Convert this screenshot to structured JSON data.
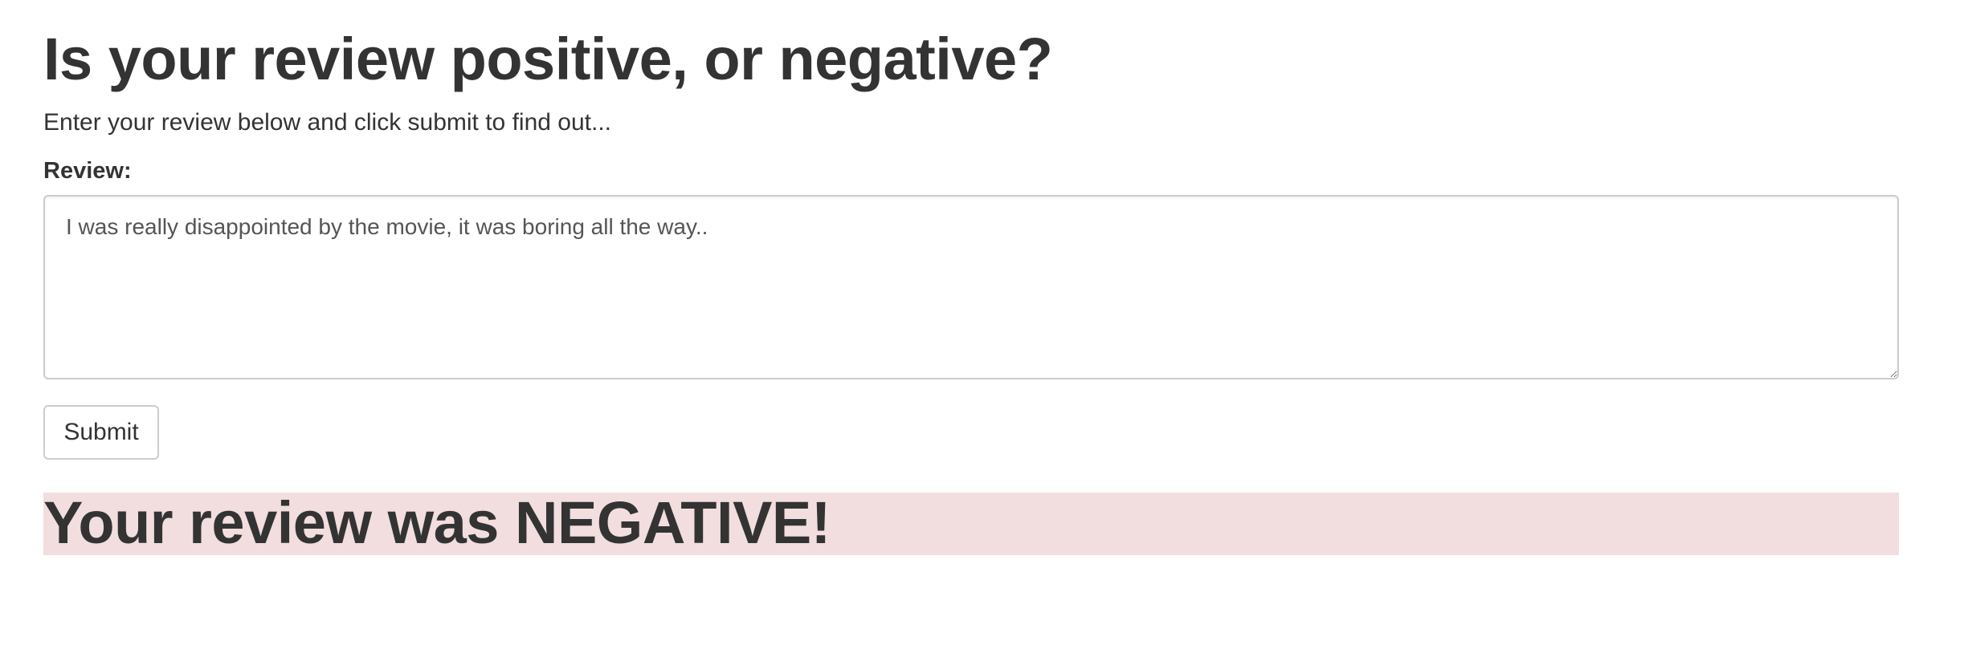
{
  "page": {
    "title": "Is your review positive, or negative?",
    "subtitle": "Enter your review below and click submit to find out..."
  },
  "form": {
    "review_label": "Review:",
    "review_value": "I was really disappointed by the movie, it was boring all the way..",
    "submit_label": "Submit"
  },
  "result": {
    "text": "Your review was NEGATIVE!",
    "sentiment": "negative",
    "background_color": "#f2dede"
  }
}
